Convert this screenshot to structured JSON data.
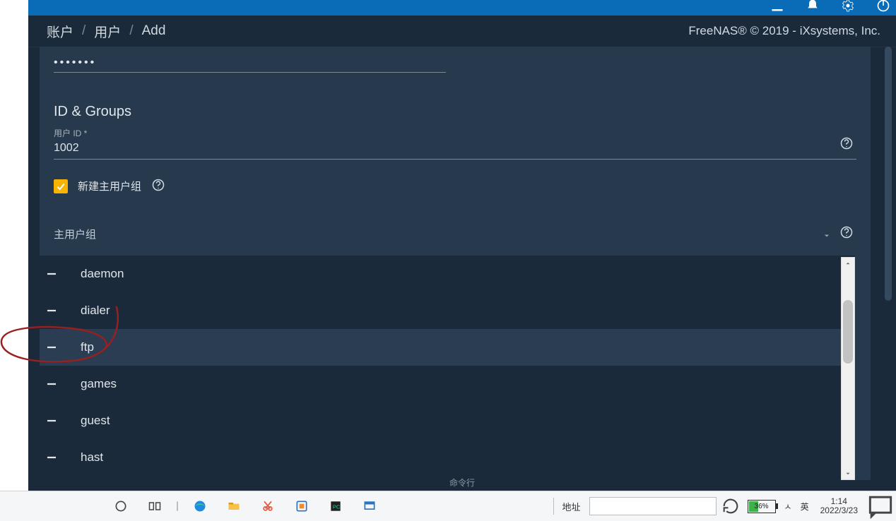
{
  "breadcrumb": {
    "l1": "账户",
    "l2": "用户",
    "l3": "Add"
  },
  "copyright": "FreeNAS® © 2019 - iXsystems, Inc.",
  "password": {
    "value": "•••••••"
  },
  "section": {
    "id_groups": "ID & Groups"
  },
  "fields": {
    "user_id_label": "用户 ID *",
    "user_id_value": "1002",
    "new_primary_group_label": "新建主用户组",
    "primary_group_label": "主用户组"
  },
  "groups": [
    {
      "name": "daemon"
    },
    {
      "name": "dialer"
    },
    {
      "name": "ftp",
      "hovered": true
    },
    {
      "name": "games"
    },
    {
      "name": "guest"
    },
    {
      "name": "hast"
    }
  ],
  "cli_label": "命令行",
  "taskbar": {
    "address_label": "地址",
    "address_value": "",
    "battery_pct": "36%",
    "ime": "英",
    "time": "1:14",
    "date": "2022/3/23"
  }
}
